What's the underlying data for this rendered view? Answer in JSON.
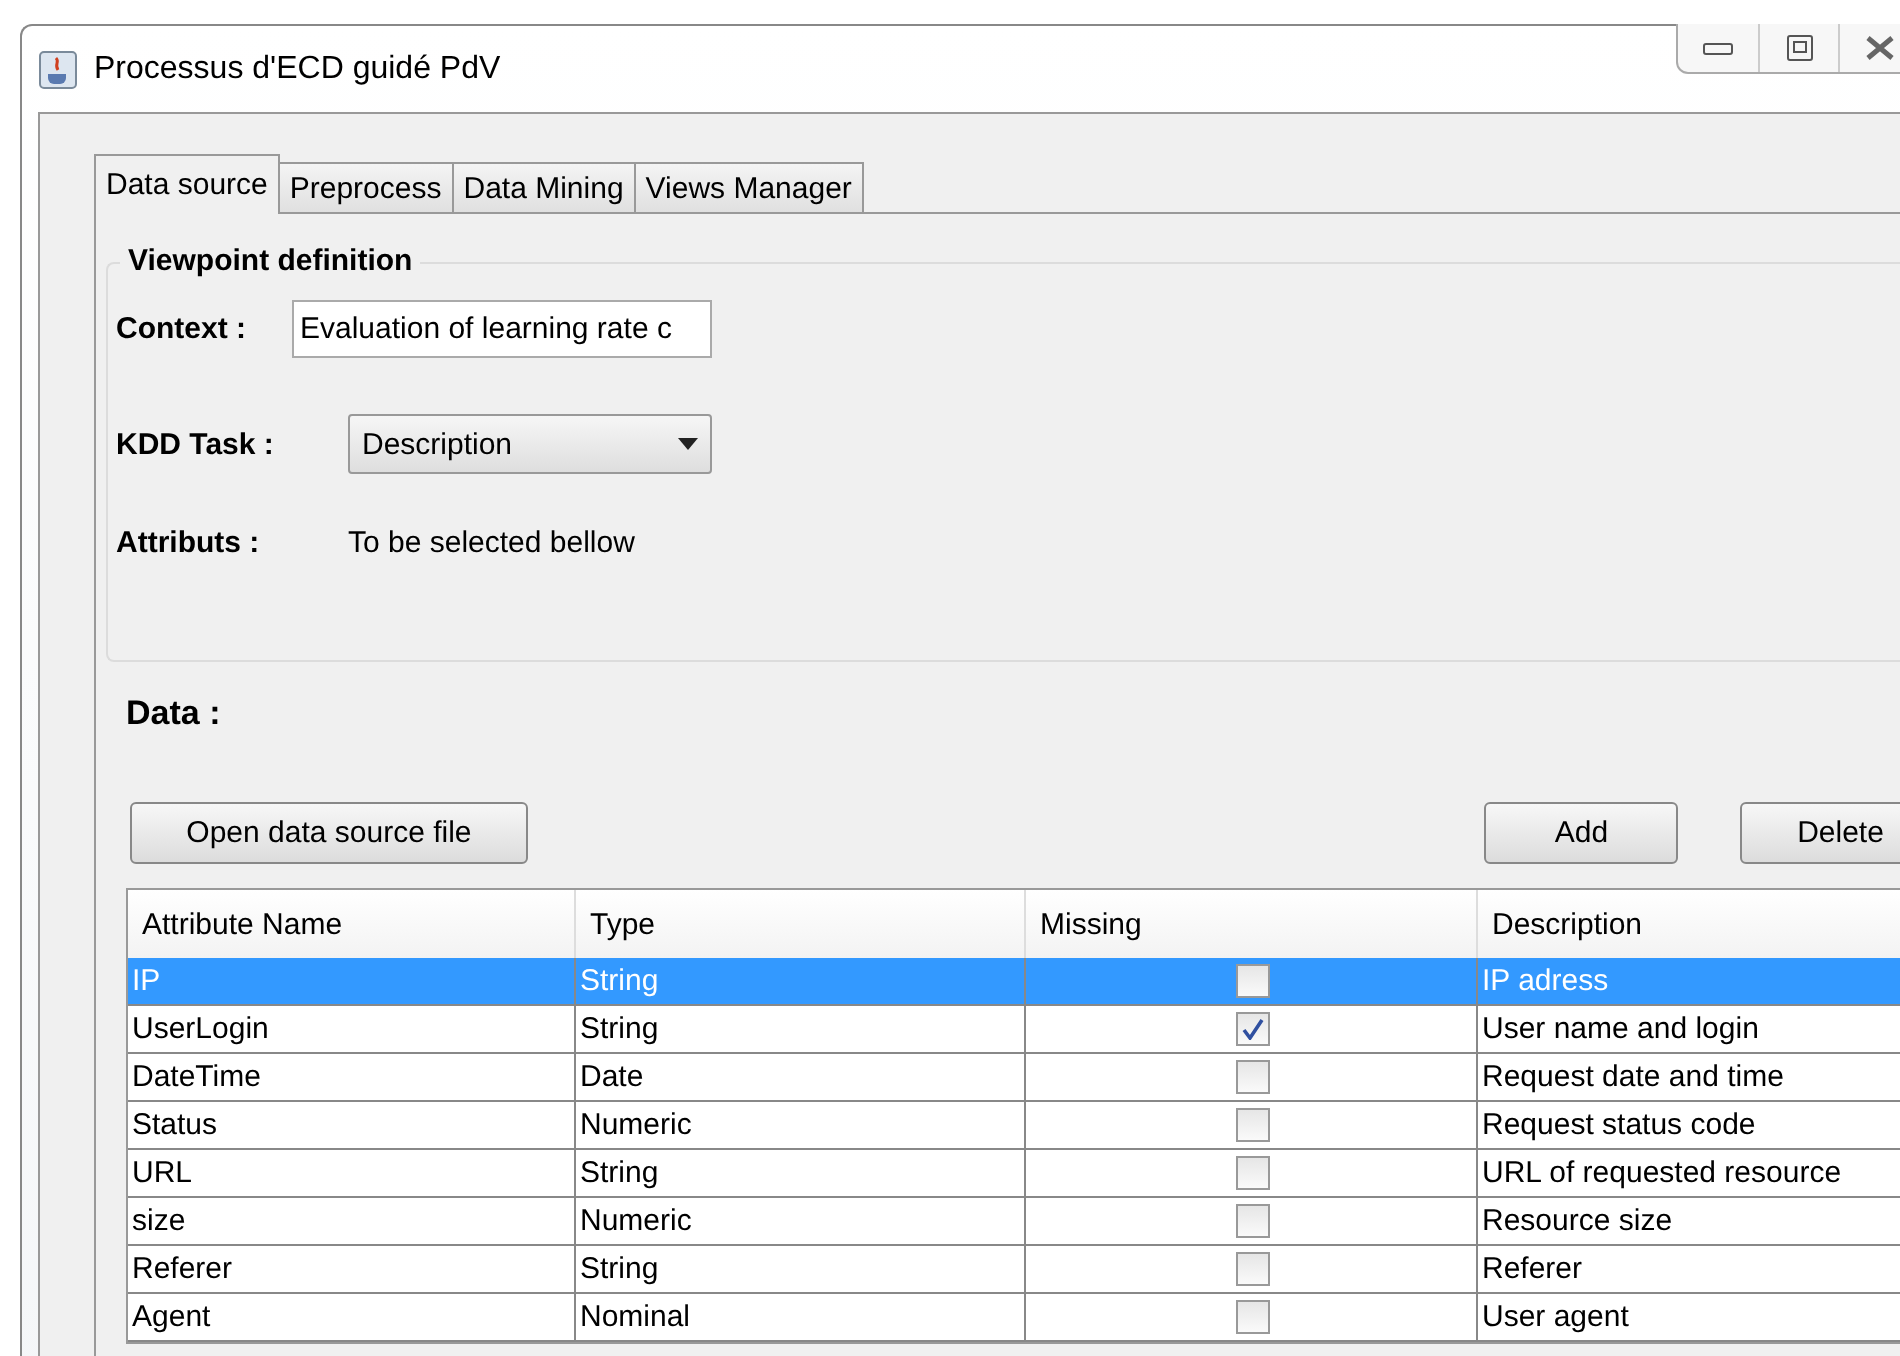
{
  "window": {
    "title": "Processus d'ECD guidé PdV"
  },
  "tabs": [
    {
      "label": "Data source",
      "selected": true
    },
    {
      "label": "Preprocess",
      "selected": false
    },
    {
      "label": "Data Mining",
      "selected": false
    },
    {
      "label": "Views Manager",
      "selected": false
    }
  ],
  "viewpoint": {
    "title": "Viewpoint definition",
    "context_label": "Context :",
    "context_value": "Evaluation of learning rate c",
    "task_label": "KDD Task :",
    "task_value": "Description",
    "attributes_label": "Attributs :",
    "attributes_value": "To be selected bellow"
  },
  "data": {
    "title": "Data :",
    "open_button": "Open data source file",
    "add_button": "Add",
    "delete_button": "Delete"
  },
  "table": {
    "columns": [
      "Attribute Name",
      "Type",
      "Missing",
      "Description"
    ],
    "rows": [
      {
        "name": "IP",
        "type": "String",
        "missing": false,
        "description": "IP adress",
        "selected": true
      },
      {
        "name": "UserLogin",
        "type": "String",
        "missing": true,
        "description": "User name and login",
        "selected": false
      },
      {
        "name": "DateTime",
        "type": "Date",
        "missing": false,
        "description": "Request date and time",
        "selected": false
      },
      {
        "name": "Status",
        "type": "Numeric",
        "missing": false,
        "description": "Request status code",
        "selected": false
      },
      {
        "name": "URL",
        "type": "String",
        "missing": false,
        "description": "URL of requested resource",
        "selected": false
      },
      {
        "name": "size",
        "type": "Numeric",
        "missing": false,
        "description": "Resource size",
        "selected": false
      },
      {
        "name": "Referer",
        "type": "String",
        "missing": false,
        "description": "Referer",
        "selected": false
      },
      {
        "name": "Agent",
        "type": "Nominal",
        "missing": false,
        "description": "User agent",
        "selected": false
      }
    ]
  }
}
